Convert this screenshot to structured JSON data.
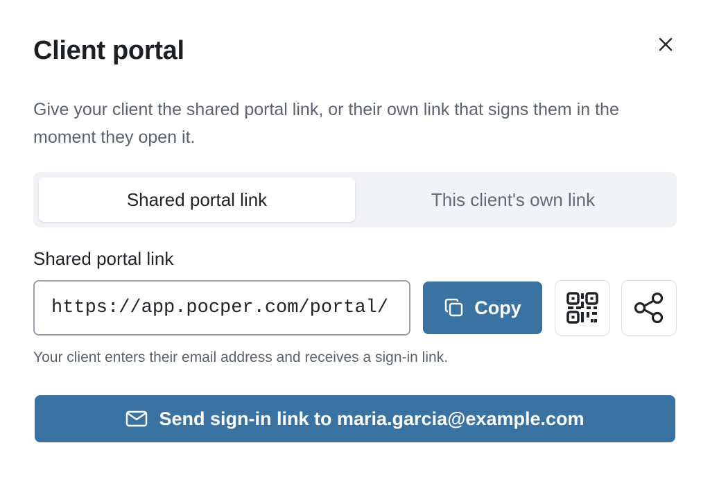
{
  "dialog": {
    "title": "Client portal",
    "description": "Give your client the shared portal link, or their own link that signs them in the moment they open it.",
    "close_icon": "close-icon"
  },
  "tabs": [
    {
      "label": "Shared portal link",
      "selected": true
    },
    {
      "label": "This client's own link",
      "selected": false
    }
  ],
  "link_section": {
    "label": "Shared portal link",
    "url": "https://app.pocper.com/portal/",
    "copy_label": "Copy",
    "copy_icon": "copy-icon",
    "qr_icon": "qr-code-icon",
    "share_icon": "share-icon",
    "hint": "Your client enters their email address and receives a sign-in link."
  },
  "send_button": {
    "label": "Send sign-in link to maria.garcia@example.com",
    "icon": "mail-icon"
  },
  "colors": {
    "primary": "#3a73a2",
    "tab_background": "#f2f3f7",
    "muted_text": "#5b6270"
  }
}
